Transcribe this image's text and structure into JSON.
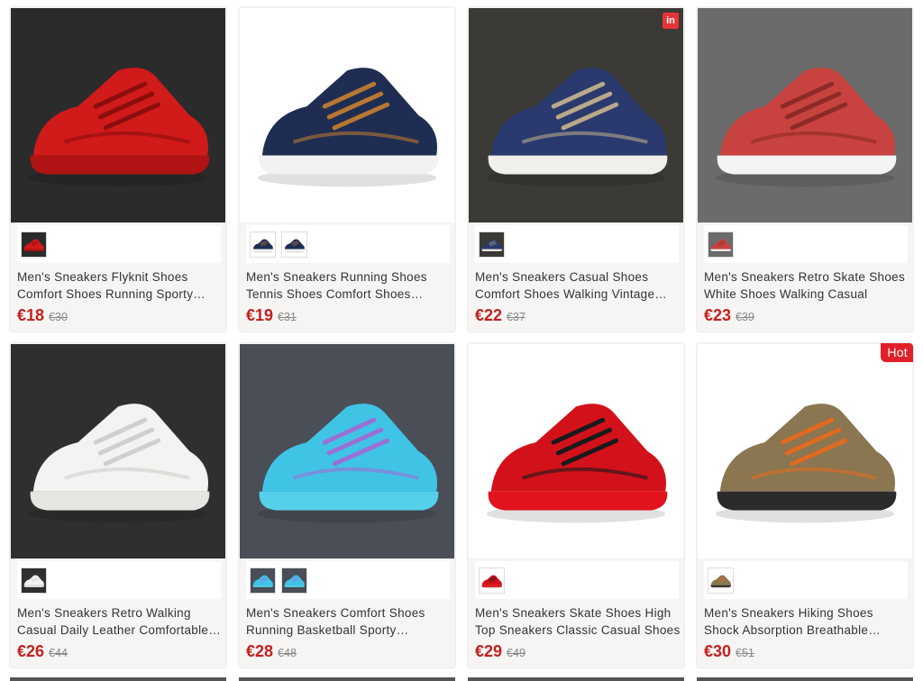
{
  "products": [
    {
      "title": "Men's Sneakers Flyknit Shoes Comfort Shoes Running Sporty Sneakers",
      "price": "€18",
      "old_price": "€30",
      "badge": "",
      "swatches": 1,
      "colors": {
        "bg": "#2b2b2b",
        "shoe": "#d11a1a",
        "sole": "#b01313",
        "accent": "#8b0d0d"
      }
    },
    {
      "title": "Men's Sneakers Running Shoes Tennis Shoes Comfort Shoes Casual",
      "price": "€19",
      "old_price": "€31",
      "badge": "",
      "swatches": 2,
      "colors": {
        "bg": "#ffffff",
        "shoe": "#1f2d52",
        "sole": "#f2f2f2",
        "accent": "#b87732"
      }
    },
    {
      "title": "Men's Sneakers Casual Shoes Comfort Shoes Walking Vintage Canvas",
      "price": "€22",
      "old_price": "€37",
      "badge": "in",
      "swatches": 1,
      "colors": {
        "bg": "#3c3a36",
        "shoe": "#2a3a6e",
        "sole": "#f1efe9",
        "accent": "#b9a98a"
      }
    },
    {
      "title": "Men's Sneakers Retro Skate Shoes White Shoes Walking Casual",
      "price": "€23",
      "old_price": "€39",
      "badge": "",
      "swatches": 1,
      "colors": {
        "bg": "#6b6b6b",
        "shoe": "#c8433f",
        "sole": "#f4f4f4",
        "accent": "#8d2a27"
      }
    },
    {
      "title": "Men's Sneakers Retro Walking Casual Daily Leather Comfortable Shoes",
      "price": "€26",
      "old_price": "€44",
      "badge": "",
      "swatches": 1,
      "colors": {
        "bg": "#2f2f2f",
        "shoe": "#f3f3f1",
        "sole": "#e5e5e2",
        "accent": "#cfcfcc"
      }
    },
    {
      "title": "Men's Sneakers Comfort Shoes Running Basketball Sporty Sneakers",
      "price": "€28",
      "old_price": "€48",
      "badge": "",
      "swatches": 2,
      "colors": {
        "bg": "#4a4e57",
        "shoe": "#3fc4e6",
        "sole": "#55d0ea",
        "accent": "#9a6fd6"
      }
    },
    {
      "title": "Men's Sneakers Skate Shoes High Top Sneakers Classic Casual Shoes",
      "price": "€29",
      "old_price": "€49",
      "badge": "",
      "swatches": 1,
      "colors": {
        "bg": "#ffffff",
        "shoe": "#d3111b",
        "sole": "#e2131d",
        "accent": "#1a1a1a"
      }
    },
    {
      "title": "Men's Sneakers Hiking Shoes Shock Absorption Breathable Outdoor",
      "price": "€30",
      "old_price": "€51",
      "badge": "Hot",
      "swatches": 1,
      "colors": {
        "bg": "#ffffff",
        "shoe": "#8a7650",
        "sole": "#2b2b2b",
        "accent": "#e06a22"
      }
    }
  ]
}
